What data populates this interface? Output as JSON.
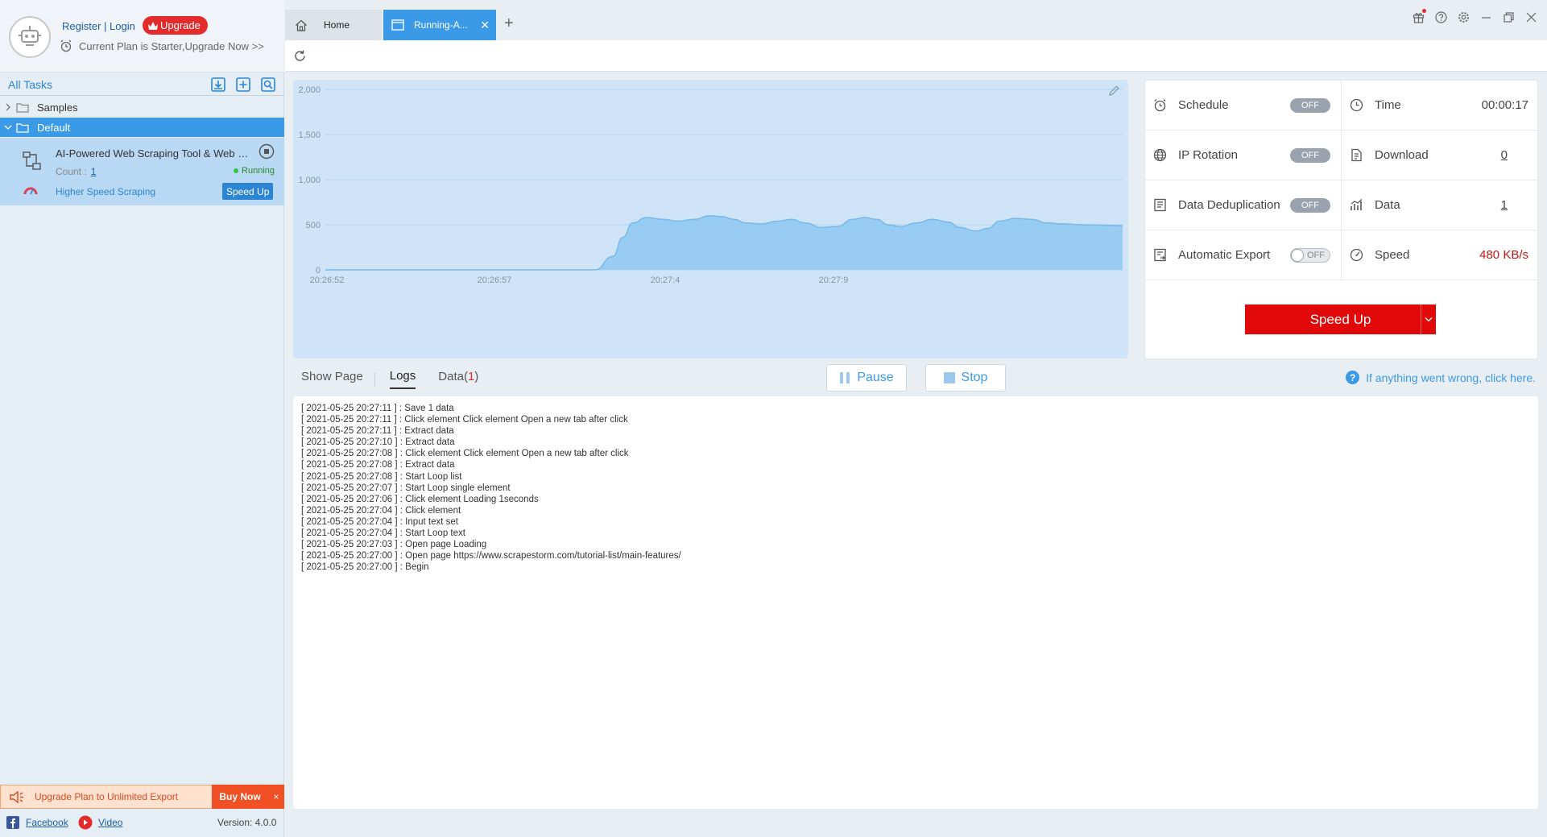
{
  "account": {
    "register_login": "Register | Login",
    "upgrade_label": "Upgrade",
    "plan_text": "Current Plan is Starter,Upgrade Now >>"
  },
  "tasks": {
    "header": "All Tasks",
    "folders": [
      {
        "label": "Samples",
        "expanded": false
      },
      {
        "label": "Default",
        "expanded": true
      }
    ],
    "task": {
      "title": "AI-Powered Web Scraping Tool & Web Dat...",
      "count_label": "Count :",
      "count_value": "1",
      "status": "Running",
      "speed_label": "Higher Speed Scraping",
      "speed_button": "Speed Up"
    }
  },
  "promo": {
    "text": "Upgrade Plan to Unlimited Export",
    "buy_now": "Buy Now",
    "close": "×"
  },
  "footer": {
    "facebook": "Facebook",
    "video": "Video",
    "version": "Version: 4.0.0"
  },
  "browser_tabs": [
    {
      "label": "Home",
      "active": false
    },
    {
      "label": "Running-A...",
      "active": true
    }
  ],
  "chart_data": {
    "type": "area",
    "x": [
      "20:26:52",
      "20:26:57",
      "20:27:4",
      "20:27:9"
    ],
    "y_ticks": [
      "0",
      "500",
      "1,000",
      "1,500",
      "2,000"
    ],
    "ylim": [
      0,
      2000
    ],
    "series": [
      {
        "values": [
          [
            0,
            0
          ],
          [
            2,
            0
          ],
          [
            4,
            0
          ],
          [
            6,
            0
          ],
          [
            8,
            0
          ],
          [
            10,
            0
          ],
          [
            12,
            0
          ],
          [
            13.6,
            0
          ],
          [
            14.5,
            150
          ],
          [
            15,
            360
          ],
          [
            15.5,
            520
          ],
          [
            16.2,
            580
          ],
          [
            17,
            560
          ],
          [
            17.8,
            540
          ],
          [
            18.6,
            560
          ],
          [
            19.4,
            600
          ],
          [
            20,
            590
          ],
          [
            20.6,
            560
          ],
          [
            21.2,
            520
          ],
          [
            22,
            510
          ],
          [
            22.8,
            540
          ],
          [
            23.5,
            560
          ],
          [
            24.2,
            520
          ],
          [
            25,
            470
          ],
          [
            25.8,
            480
          ],
          [
            26.6,
            560
          ],
          [
            27.2,
            580
          ],
          [
            27.8,
            560
          ],
          [
            28.4,
            500
          ],
          [
            29,
            480
          ],
          [
            29.8,
            520
          ],
          [
            30.6,
            560
          ],
          [
            31.4,
            530
          ],
          [
            32,
            470
          ],
          [
            32.8,
            430
          ],
          [
            33.4,
            460
          ],
          [
            34,
            540
          ],
          [
            34.8,
            570
          ],
          [
            35.6,
            560
          ],
          [
            36.4,
            520
          ],
          [
            37.2,
            510
          ],
          [
            38.2,
            500
          ],
          [
            40.2,
            490
          ]
        ]
      }
    ],
    "fill_color": "#8ec8f2",
    "line_color": "#78b8ea",
    "grid": true
  },
  "stats": {
    "schedule": {
      "label": "Schedule",
      "toggle": "OFF"
    },
    "ip_rotation": {
      "label": "IP Rotation",
      "toggle": "OFF"
    },
    "dedup": {
      "label": "Data Deduplication",
      "toggle": "OFF"
    },
    "auto_export": {
      "label": "Automatic Export",
      "toggle": "OFF"
    },
    "time": {
      "label": "Time",
      "value": "00:00:17"
    },
    "download": {
      "label": "Download",
      "value": "0"
    },
    "data": {
      "label": "Data",
      "value": "1"
    },
    "speed": {
      "label": "Speed",
      "value": "480 KB/s"
    },
    "speed_up_button": "Speed Up"
  },
  "view_tabs": {
    "show_page": "Show Page",
    "logs": "Logs",
    "data": "Data(",
    "data_count": "1",
    "data_close": ")"
  },
  "controls": {
    "pause": "Pause",
    "stop": "Stop",
    "help": "If anything went wrong, click here."
  },
  "logs": [
    "[ 2021-05-25 20:27:11 ] : Save 1 data",
    "[ 2021-05-25 20:27:11 ] : Click element Click element Open a new tab after click",
    "[ 2021-05-25 20:27:11 ] : Extract data",
    "[ 2021-05-25 20:27:10 ] : Extract data",
    "[ 2021-05-25 20:27:08 ] : Click element Click element Open a new tab after click",
    "[ 2021-05-25 20:27:08 ] : Extract data",
    "[ 2021-05-25 20:27:08 ] : Start Loop list",
    "[ 2021-05-25 20:27:07 ] : Start Loop single element",
    "[ 2021-05-25 20:27:06 ] : Click element Loading 1seconds",
    "[ 2021-05-25 20:27:04 ] : Click element",
    "[ 2021-05-25 20:27:04 ] : Input text set",
    "[ 2021-05-25 20:27:04 ] : Start Loop text",
    "[ 2021-05-25 20:27:03 ] : Open page Loading",
    "[ 2021-05-25 20:27:00 ] : Open page https://www.scrapestorm.com/tutorial-list/main-features/",
    "[ 2021-05-25 20:27:00 ] : Begin"
  ],
  "colors": {
    "accent": "#3b9ae8",
    "danger": "#e00808",
    "upgrade": "#e42b2b"
  }
}
